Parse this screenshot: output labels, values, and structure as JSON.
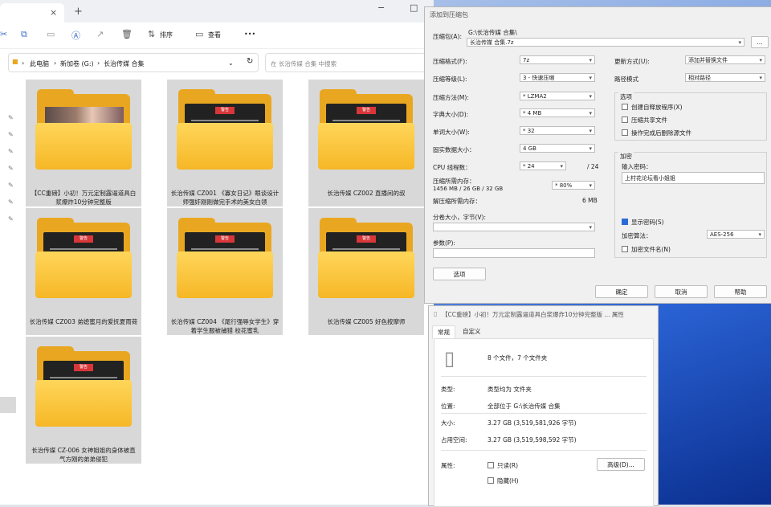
{
  "explorer": {
    "tab_new": "+",
    "tab_close": "×",
    "window_minimize": "−",
    "window_maximize": "□",
    "toolbar": {
      "sort": "排序",
      "view": "查看",
      "more": "•••"
    },
    "breadcrumb": [
      "此电脑",
      "新加卷 (G:)",
      "长治传媒 合集"
    ],
    "search_placeholder": "在 长治传媒 合集 中搜索",
    "folders": [
      {
        "label": "【CC重磅】小初！万元定制露逼道具白浆爆炸10分钟完整版"
      },
      {
        "label": "长治传媒 CZ001 《寡女日记》眼谈设计师强奸刚刚做完手术的美女白领"
      },
      {
        "label": "长治传媒 CZ002 直播间的叔"
      },
      {
        "label": "长治传媒 CZ003 弟媳蜜月的爱抚夏雨荷"
      },
      {
        "label": "长治传媒 CZ004 《尾行强辱女学生》穿着学生服被捕猎 校花蜜乳"
      },
      {
        "label": "长治传媒 CZ005 好色按摩师"
      },
      {
        "label": "长治传媒 CZ-006 女神姐姐的身体被直气方刚的弟弟侵犯"
      }
    ],
    "folder_doc_badge": "警告"
  },
  "archive_dialog": {
    "title": "添加到压缩包",
    "archive_label": "压缩包(A):",
    "archive_path": "G:\\长治传媒 合集\\",
    "archive_name": "长治传媒 合集.7z",
    "browse": "...",
    "format_label": "压缩格式(F):",
    "format_value": "7z",
    "level_label": "压缩等级(L):",
    "level_value": "3 - 快速压缩",
    "method_label": "压缩方法(M):",
    "method_value": "* LZMA2",
    "dict_label": "字典大小(D):",
    "dict_value": "* 4 MB",
    "word_label": "单词大小(W):",
    "word_value": "* 32",
    "solid_label": "固实数据大小：",
    "solid_value": "4 GB",
    "threads_label": "CPU 线程数：",
    "threads_value": "* 24",
    "threads_total": "/ 24",
    "mem_label": "压缩所需内存：",
    "mem_value": "1456 MB / 26 GB / 32 GB",
    "mem_pct": "* 80%",
    "demem_label": "解压缩所需内存：",
    "demem_value": "6 MB",
    "split_label": "分卷大小，字节(V):",
    "params_label": "参数(P):",
    "options_button": "选项",
    "update_label": "更新方式(U):",
    "update_value": "添加并替换文件",
    "path_label": "路径模式",
    "path_value": "相对路径",
    "options_group": "选项",
    "opt_sfx": "创建自释放程序(X)",
    "opt_shared": "压缩共享文件",
    "opt_delete": "操作完成后删除源文件",
    "encrypt_group": "加密",
    "password_label": "输入密码：",
    "password_value": "上村花论坛看小姐姐",
    "show_password": "显示密码(S)",
    "enc_method_label": "加密算法：",
    "enc_method_value": "AES-256",
    "encrypt_names": "加密文件名(N)",
    "ok": "确定",
    "cancel": "取消",
    "help": "帮助"
  },
  "properties_dialog": {
    "title": "【CC重磅】小初！万元定制露逼道具白浆爆炸10分钟完整版 ... 属性",
    "tab_general": "常规",
    "tab_custom": "自定义",
    "contents": "8 个文件，7 个文件夹",
    "type_label": "类型:",
    "type_value": "类型均为 文件夹",
    "location_label": "位置:",
    "location_value": "全部位于 G:\\长治传媒 合集",
    "size_label": "大小:",
    "size_value": "3.27 GB (3,519,581,926 字节)",
    "disk_label": "占用空间:",
    "disk_value": "3.27 GB (3,519,598,592 字节)",
    "attr_label": "属性:",
    "readonly": "只读(R)",
    "hidden": "隐藏(H)",
    "advanced": "高级(D)..."
  }
}
